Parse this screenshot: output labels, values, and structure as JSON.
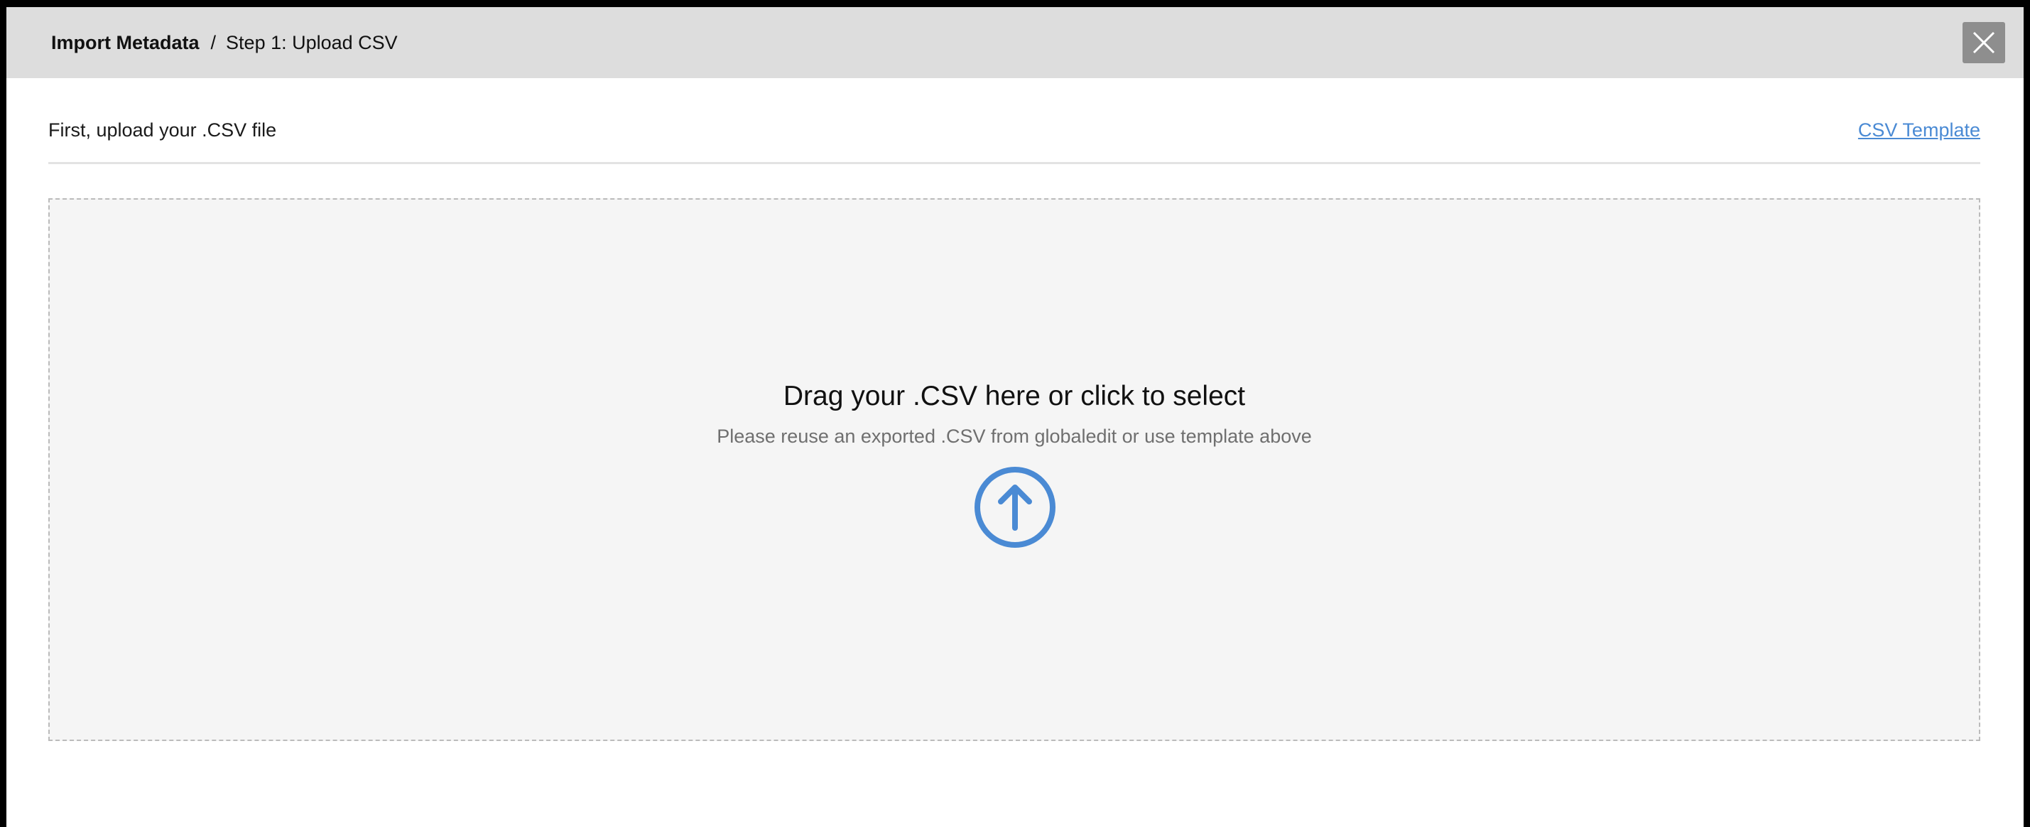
{
  "header": {
    "title": "Import Metadata",
    "separator": "/",
    "step": "Step 1: Upload CSV",
    "close_icon": "close-icon"
  },
  "upload_section": {
    "label": "First, upload your .CSV file",
    "template_link": "CSV Template"
  },
  "dropzone": {
    "title": "Drag your .CSV here or click to select",
    "subtitle": "Please reuse an exported .CSV from globaledit or use template above",
    "icon": "upload-arrow-icon"
  },
  "colors": {
    "header_bg": "#dddddd",
    "close_button_bg": "#8e8e8e",
    "accent": "#4a8ad4",
    "dropzone_bg": "#f5f5f5"
  }
}
